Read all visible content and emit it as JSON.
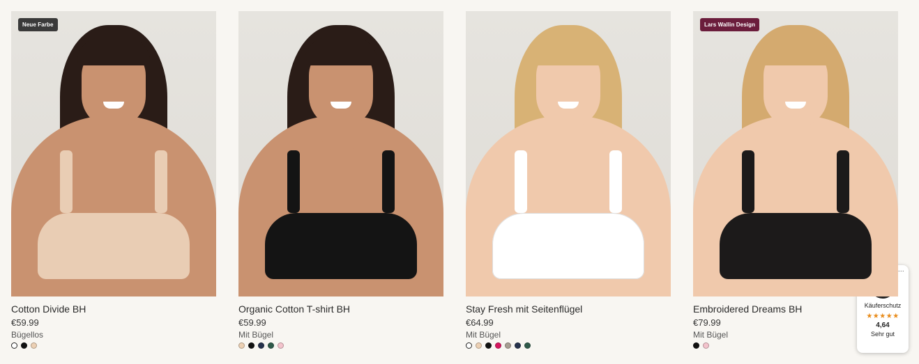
{
  "products": [
    {
      "name": "Cotton Divide BH",
      "price": "€59.99",
      "type": "Bügellos",
      "badge": "Neue Farbe",
      "badge_color": "#3a3a3a",
      "skin": "#c99270",
      "hair": "#2a1c17",
      "bra_color": "#e9cdb4",
      "swatches": [
        "#ffffff",
        "#111111",
        "#ecd0b4"
      ]
    },
    {
      "name": "Organic Cotton T-shirt BH",
      "price": "€59.99",
      "type": "Mit Bügel",
      "badge": "",
      "badge_color": "",
      "skin": "#c99270",
      "hair": "#2a1c17",
      "bra_color": "#141414",
      "swatches": [
        "#ecd0b4",
        "#111111",
        "#26324d",
        "#2f5a4a",
        "#f3c3cc"
      ]
    },
    {
      "name": "Stay Fresh mit Seitenflügel",
      "price": "€64.99",
      "type": "Mit Bügel",
      "badge": "",
      "badge_color": "",
      "skin": "#f0c9ac",
      "hair": "#d8b275",
      "bra_color": "#ffffff",
      "swatches": [
        "#ffffff",
        "#ecd0b4",
        "#111111",
        "#d6175f",
        "#a89f93",
        "#26324d",
        "#2f5a4a"
      ]
    },
    {
      "name": "Embroidered Dreams BH",
      "price": "€79.99",
      "type": "Mit Bügel",
      "badge": "Lars Wallin Design",
      "badge_color": "#6b1d3c",
      "skin": "#f0c9ac",
      "hair": "#d4aa6f",
      "bra_color": "#1c1a1a",
      "swatches": [
        "#111111",
        "#f3c3cc"
      ]
    }
  ],
  "trust_badge": {
    "label": "Käuferschutz",
    "stars": "★★★★★",
    "score": "4,64",
    "verdict": "Sehr gut",
    "seal_letter": "e",
    "more": "..."
  }
}
